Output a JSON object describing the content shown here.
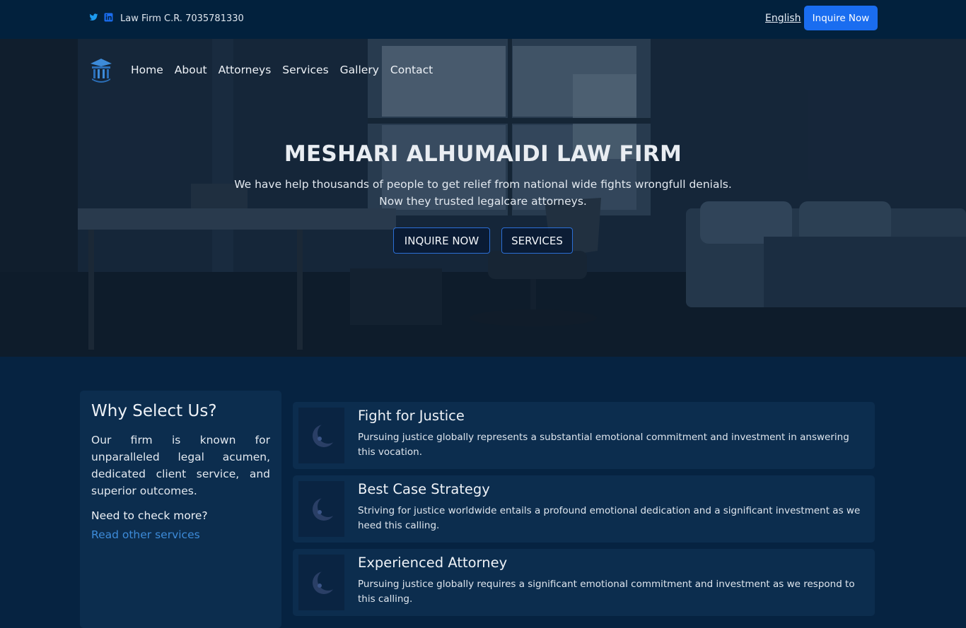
{
  "topbar": {
    "social_icons": [
      "twitter-icon",
      "linkedin-icon"
    ],
    "company_reg": "Law Firm C.R. 7035781330",
    "language": "English",
    "inquire_button": "Inquire Now"
  },
  "nav": {
    "items": [
      "Home",
      "About",
      "Attorneys",
      "Services",
      "Gallery",
      "Contact"
    ]
  },
  "hero": {
    "title": "MESHARI ALHUMAIDI LAW FIRM",
    "subtitle_line1": "We have help thousands of people to get relief from national wide fights wrongfull denials.",
    "subtitle_line2": "Now they trusted legalcare attorneys.",
    "primary_button": "INQUIRE NOW",
    "secondary_button": "SERVICES"
  },
  "why": {
    "heading": "Why Select Us?",
    "description": "Our firm is known for unparalleled legal acumen, dedicated client service, and superior outcomes.",
    "prompt": "Need to check more?",
    "link": "Read other services"
  },
  "features": [
    {
      "title": "Fight for Justice",
      "text": "Pursuing justice globally represents a substantial emotional commitment and investment in answering this vocation."
    },
    {
      "title": "Best Case Strategy",
      "text": "Striving for justice worldwide entails a profound emotional dedication and a significant investment as we heed this calling."
    },
    {
      "title": "Experienced Attorney",
      "text": "Pursuing justice globally requires a significant emotional commitment and investment as we respond to this calling."
    }
  ],
  "colors": {
    "accent": "#1a6df0",
    "link": "#3d8bd9",
    "page_background": "#062341",
    "card_background": "#0c2d4e"
  }
}
